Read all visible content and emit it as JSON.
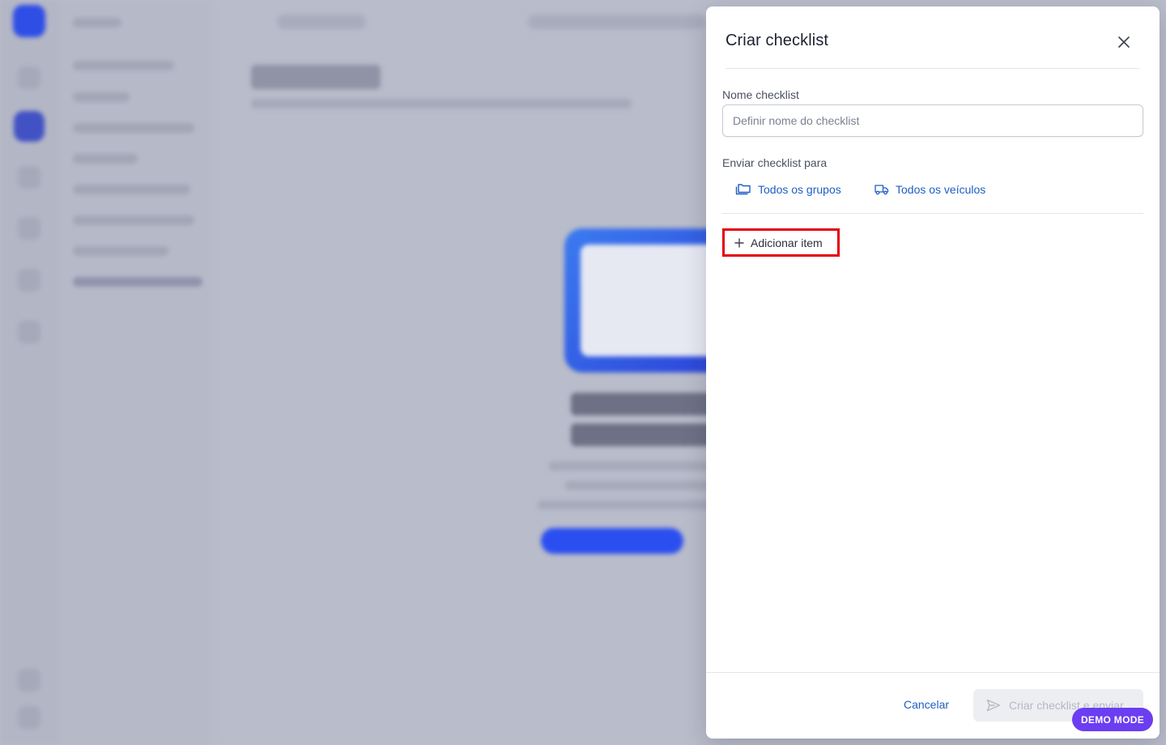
{
  "drawer": {
    "title": "Criar checklist",
    "close_icon": "close-icon",
    "name_field": {
      "label": "Nome checklist",
      "placeholder": "Definir nome do checklist",
      "value": ""
    },
    "send_to": {
      "label": "Enviar checklist para",
      "groups": {
        "label": "Todos os grupos",
        "icon": "folders-icon"
      },
      "vehicles": {
        "label": "Todos os veículos",
        "icon": "truck-icon"
      }
    },
    "add_item": {
      "label": "Adicionar item",
      "icon": "plus-icon",
      "highlight_color": "#e3000f"
    },
    "footer": {
      "cancel_label": "Cancelar",
      "submit_label": "Criar checklist e enviar",
      "submit_icon": "send-icon"
    }
  },
  "demo_badge": "DEMO MODE",
  "colors": {
    "accent": "#1f5ec4",
    "brand": "#2f4ee6",
    "demo_badge": "#6b3ef2",
    "highlight": "#e3000f"
  }
}
